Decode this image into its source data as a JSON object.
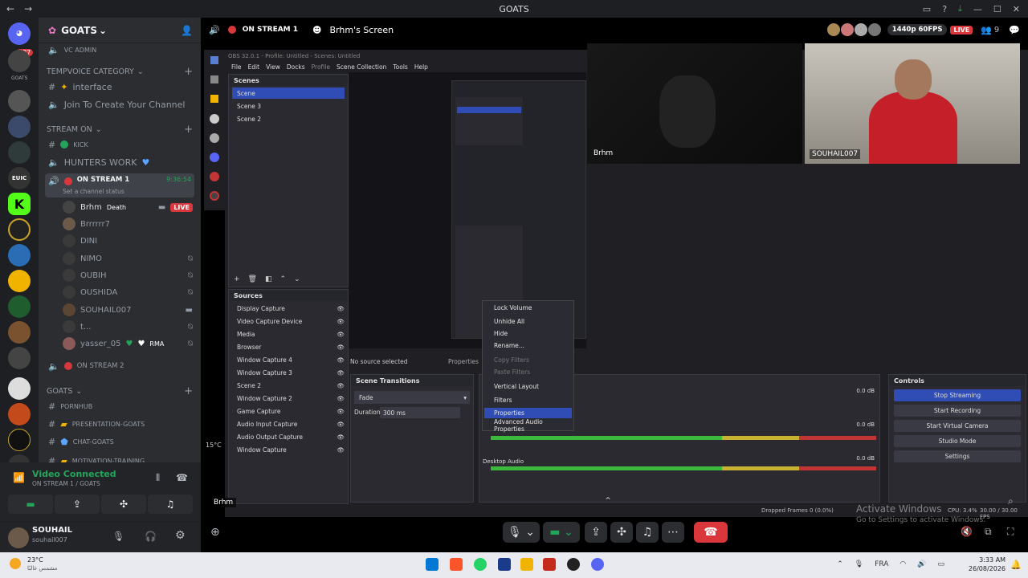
{
  "window": {
    "title": "GOATS"
  },
  "server": {
    "name": "GOATS",
    "badge": "437"
  },
  "channels": {
    "vc_admin": "VC ADMIN",
    "cat_tempvoice": "TEMPVOICE CATEGORY",
    "interface": "interface",
    "join_create": "Join To Create Your Channel",
    "cat_stream": "STREAM ON",
    "kick": "KICK",
    "hunters": "HUNTERS WORK",
    "on_stream_1": "ON STREAM 1",
    "on_stream_1_time": "9:36:54",
    "set_status": "Set a channel status",
    "on_stream_2": "ON STREAM 2",
    "cat_goats": "GOATS",
    "pornhub": "PORNHUB",
    "presentation": "PRESENTATION-GOATS",
    "chat": "CHAT-GOATS",
    "motivation": "MOTIVATION-TRAINING"
  },
  "members": [
    {
      "name": "Brhm",
      "extra": "Death",
      "live": "LIVE"
    },
    {
      "name": "Brrrrrr7"
    },
    {
      "name": "DINI"
    },
    {
      "name": "NIMO"
    },
    {
      "name": "OUBIH"
    },
    {
      "name": "OUSHIDA"
    },
    {
      "name": "SOUHAIL007"
    },
    {
      "name": "t..."
    },
    {
      "name": "yasser_05",
      "extra": "RMA"
    }
  ],
  "voice": {
    "status": "Video Connected",
    "channel": "ON STREAM 1 / GOATS"
  },
  "user": {
    "name": "SOUHAIL",
    "tag": "souhail007"
  },
  "stream": {
    "channel": "ON STREAM 1",
    "title": "Brhm's Screen",
    "quality": "1440p 60FPS",
    "live": "LIVE",
    "viewers": "9"
  },
  "obs": {
    "title": "OBS 32.0.1 - Profile: Untitled - Scenes: Untitled",
    "menu": [
      "File",
      "Edit",
      "View",
      "Docks",
      "Profile",
      "Scene Collection",
      "Tools",
      "Help"
    ],
    "scenes_title": "Scenes",
    "scenes": [
      "Scene",
      "Scene 3",
      "Scene 2"
    ],
    "sources_title": "Sources",
    "sources": [
      "Display Capture",
      "Video Capture Device",
      "Media",
      "Browser",
      "Window Capture 4",
      "Window Capture 3",
      "Scene 2",
      "Window Capture 2",
      "Game Capture",
      "Audio Input Capture",
      "Audio Output Capture",
      "Window Capture"
    ],
    "no_source": "No source selected",
    "properties": "Properties",
    "transitions_title": "Scene Transitions",
    "transition": "Fade",
    "duration_label": "Duration",
    "duration": "300 ms",
    "controls_title": "Controls",
    "controls": [
      "Stop Streaming",
      "Start Recording",
      "Start Virtual Camera",
      "Studio Mode",
      "Settings"
    ],
    "desktop_audio": "Desktop Audio",
    "db": "0.0 dB",
    "context_menu": [
      "Lock Volume",
      "Unhide All",
      "Hide",
      "Rename...",
      "Copy Filters",
      "Paste Filters",
      "Vertical Layout",
      "Filters",
      "Properties",
      "Advanced Audio Properties"
    ],
    "status": "Dropped Frames 0 (0.0%)",
    "cpu": "CPU: 3.4%",
    "fps": "30.00 / 30.00 FPS"
  },
  "cams": [
    {
      "name": "Brhm"
    },
    {
      "name": "SOUHAIL007"
    }
  ],
  "streamer_tag": "Brhm",
  "activate": {
    "line1": "Activate Windows",
    "line2": "Go to Settings to activate Windows."
  },
  "taskbar": {
    "temp": "23°C",
    "weather": "مشمس غالبًا",
    "lang": "FRA",
    "time": "3:33 AM",
    "date": "26/08/2026",
    "small_temp": "15°C"
  }
}
